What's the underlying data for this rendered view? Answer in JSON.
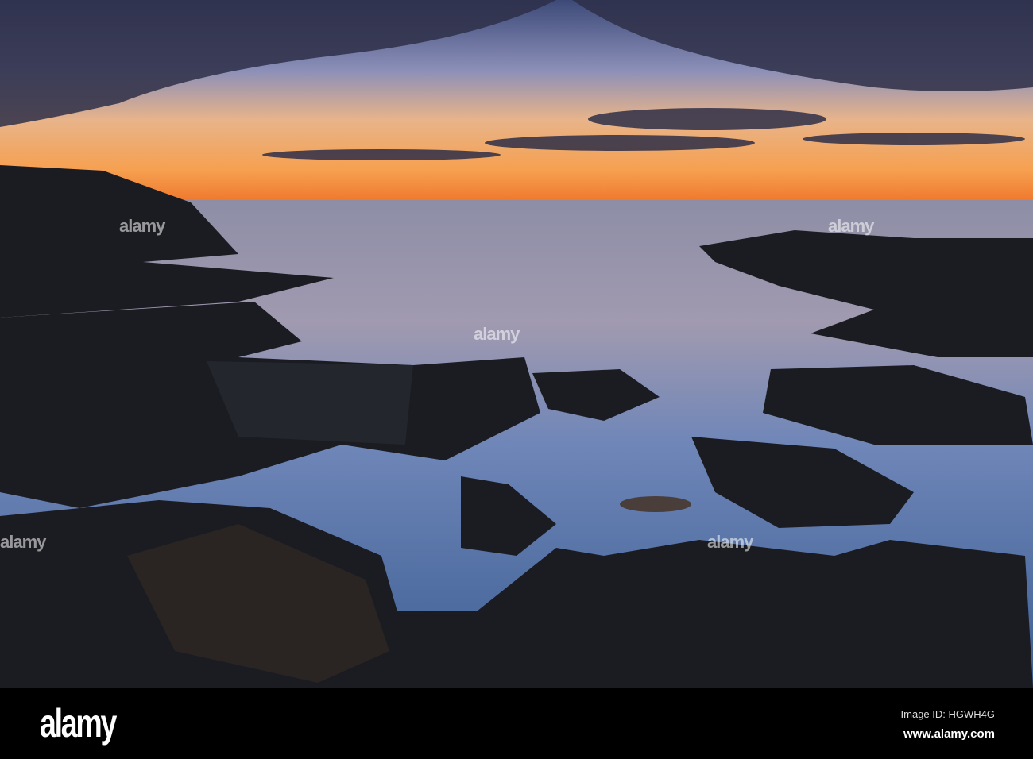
{
  "photo": {
    "subject": "rocky-shoreline-at-sunrise",
    "colors": {
      "sky_top": "#4a5a8c",
      "horizon": "#f08a3a",
      "water": "#6f86b8",
      "rock": "#1b1c22"
    }
  },
  "watermark": {
    "text": "alamy"
  },
  "footer": {
    "logo": "alamy",
    "image_id": "Image ID: HGWH4G",
    "url": "www.alamy.com"
  }
}
